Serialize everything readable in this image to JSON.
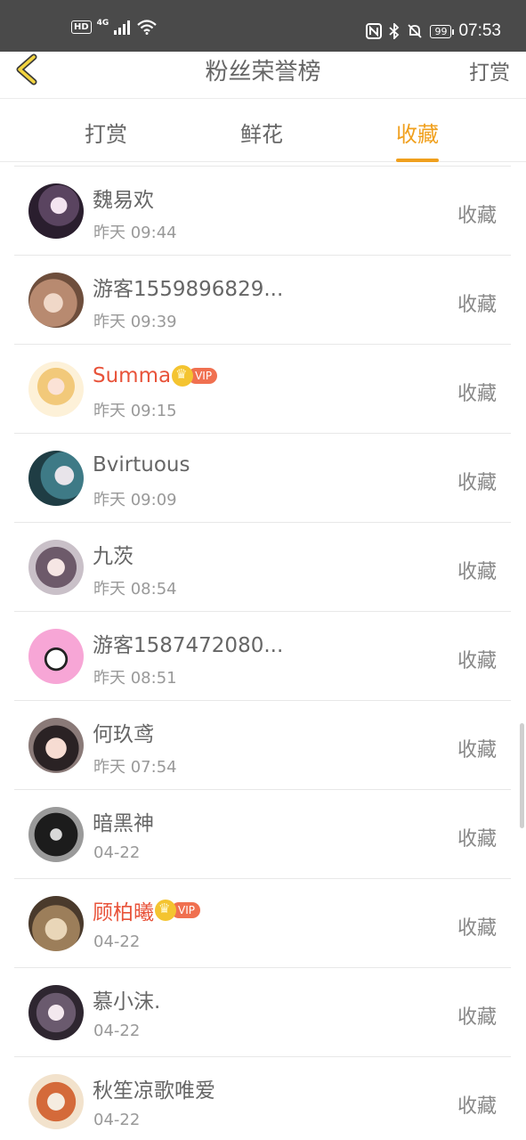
{
  "status_bar": {
    "hd": "HD",
    "network": "4G",
    "battery": "99",
    "time": "07:53",
    "icons": [
      "signal-icon",
      "wifi-icon",
      "nfc-icon",
      "bluetooth-icon",
      "bell-off-icon"
    ]
  },
  "header": {
    "title": "粉丝荣誉榜",
    "action": "打赏",
    "back_icon": "chevron-left-icon"
  },
  "tabs": [
    {
      "label": "打赏",
      "active": false
    },
    {
      "label": "鲜花",
      "active": false
    },
    {
      "label": "收藏",
      "active": true
    }
  ],
  "colors": {
    "accent": "#f0a01e",
    "vip_name": "#e8533a",
    "vip_badge": "#f07050",
    "status_bar": "#4a4a4a"
  },
  "rows": [
    {
      "name": "魏易欢",
      "time": "昨天 09:44",
      "action": "收藏",
      "vip": false
    },
    {
      "name": "游客1559896829...",
      "time": "昨天 09:39",
      "action": "收藏",
      "vip": false
    },
    {
      "name": "Summa",
      "time": "昨天 09:15",
      "action": "收藏",
      "vip": true,
      "badge": "VIP"
    },
    {
      "name": "Bvirtuous",
      "time": "昨天 09:09",
      "action": "收藏",
      "vip": false
    },
    {
      "name": "九茨",
      "time": "昨天 08:54",
      "action": "收藏",
      "vip": false
    },
    {
      "name": "游客1587472080...",
      "time": "昨天 08:51",
      "action": "收藏",
      "vip": false
    },
    {
      "name": "何玖鸢",
      "time": "昨天 07:54",
      "action": "收藏",
      "vip": false
    },
    {
      "name": "暗黑神",
      "time": "04-22",
      "action": "收藏",
      "vip": false
    },
    {
      "name": "顾柏曦",
      "time": "04-22",
      "action": "收藏",
      "vip": true,
      "badge": "VIP"
    },
    {
      "name": "慕小沫.",
      "time": "04-22",
      "action": "收藏",
      "vip": false
    },
    {
      "name": "秋笙凉歌唯爱",
      "time": "04-22",
      "action": "收藏",
      "vip": false
    }
  ]
}
